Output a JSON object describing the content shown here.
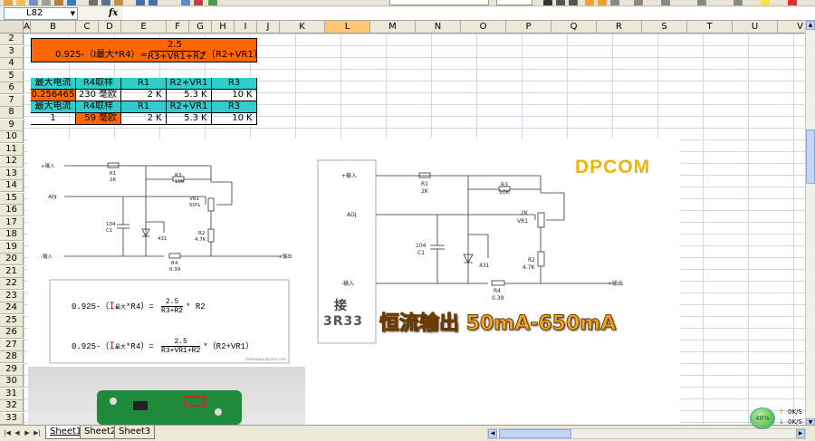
{
  "name_box": {
    "value": "L82"
  },
  "formula_bar": {
    "fx_label": "fx",
    "content": ""
  },
  "columns": [
    "A",
    "B",
    "C",
    "D",
    "E",
    "F",
    "G",
    "H",
    "I",
    "J",
    "K",
    "L",
    "M",
    "N",
    "O",
    "P",
    "Q",
    "R",
    "S",
    "T",
    "U",
    "V"
  ],
  "selected_column": "L",
  "rows": [
    "2",
    "3",
    "4",
    "5",
    "6",
    "7",
    "8",
    "9",
    "10",
    "11",
    "12",
    "13",
    "14",
    "15",
    "16",
    "17",
    "18",
    "19",
    "20",
    "21",
    "22",
    "23",
    "24",
    "25",
    "26",
    "27",
    "28",
    "29",
    "30",
    "31",
    "32",
    "33"
  ],
  "formula_banner": {
    "left": "0.925-（I最大*R4）=",
    "numerator": "2.5",
    "denominator": "R3+VR1+R2",
    "right": "*（R2+VR1）"
  },
  "table": {
    "row5": [
      "最大电流",
      "R4取样",
      "R1",
      "R2+VR1",
      "R3"
    ],
    "row6": [
      "0.256465",
      "230",
      "毫欧",
      "2",
      "K",
      "5.3",
      "K",
      "10",
      "K"
    ],
    "row7": [
      "最大电流",
      "R4取样",
      "R1",
      "R2+VR1",
      "R3"
    ],
    "row8": [
      "1",
      "59",
      "毫欧",
      "2",
      "K",
      "5.3",
      "K",
      "10",
      "K"
    ]
  },
  "schematic_left": {
    "in_plus": "+输入",
    "adj": "ADJ",
    "in_minus": "-输入",
    "out_plus": "+输出",
    "out_minus": "-输出",
    "r1": "R1",
    "r1v": "2K",
    "r3": "R3",
    "r3v": "10K",
    "vr1": "VR1",
    "vr1v": "50%",
    "c1": "104",
    "c1n": "C1",
    "d": "431",
    "r2": "R2",
    "r2v": "4.7K",
    "r4": "R4",
    "r4v": "0.39"
  },
  "equations": {
    "eq1_left": "0.925-（",
    "eq1_i": "I",
    "eq1_sub": "最大",
    "eq1_mid": "*R4）=",
    "eq1_num": "2.5",
    "eq1_den": "R3+R2",
    "eq1_right": "* R2",
    "eq2_left": "0.925-（",
    "eq2_i": "I",
    "eq2_sub": "最大",
    "eq2_mid": "*R4）=",
    "eq2_num": "2.5",
    "eq2_den": "R3+VR1+R2",
    "eq2_right": "*（R2+VR1）",
    "watermark": "draw.www.dpcom.com"
  },
  "schematic_right": {
    "in_plus": "+输入",
    "adj": "ADJ",
    "in_minus": "-输入",
    "out_plus": "+输出",
    "out_minus": "-输出",
    "r1": "R1",
    "r1v": "2K",
    "r3": "R3",
    "r3v": "10K",
    "vr1": "VR1",
    "vr1v": "2K",
    "c1": "104",
    "c1n": "C1",
    "d": "431",
    "r2": "R2",
    "r2v": "4.7K",
    "r4": "R4",
    "r4v": "0.39"
  },
  "brand": "DPCOM",
  "side_note": {
    "line1": "接",
    "line2": "3R33"
  },
  "headline": "恒流输出 50mA-650mA",
  "sheet_tabs": [
    "Sheet1",
    "Sheet2",
    "Sheet3"
  ],
  "active_sheet": "Sheet1",
  "net_widget": {
    "percent": "48%",
    "up": "0K/S",
    "down": "0K/S"
  },
  "colors": {
    "orange": "#ff6600",
    "cyan": "#33cccc",
    "headline": "#f5a623",
    "brand": "#f0b400"
  }
}
